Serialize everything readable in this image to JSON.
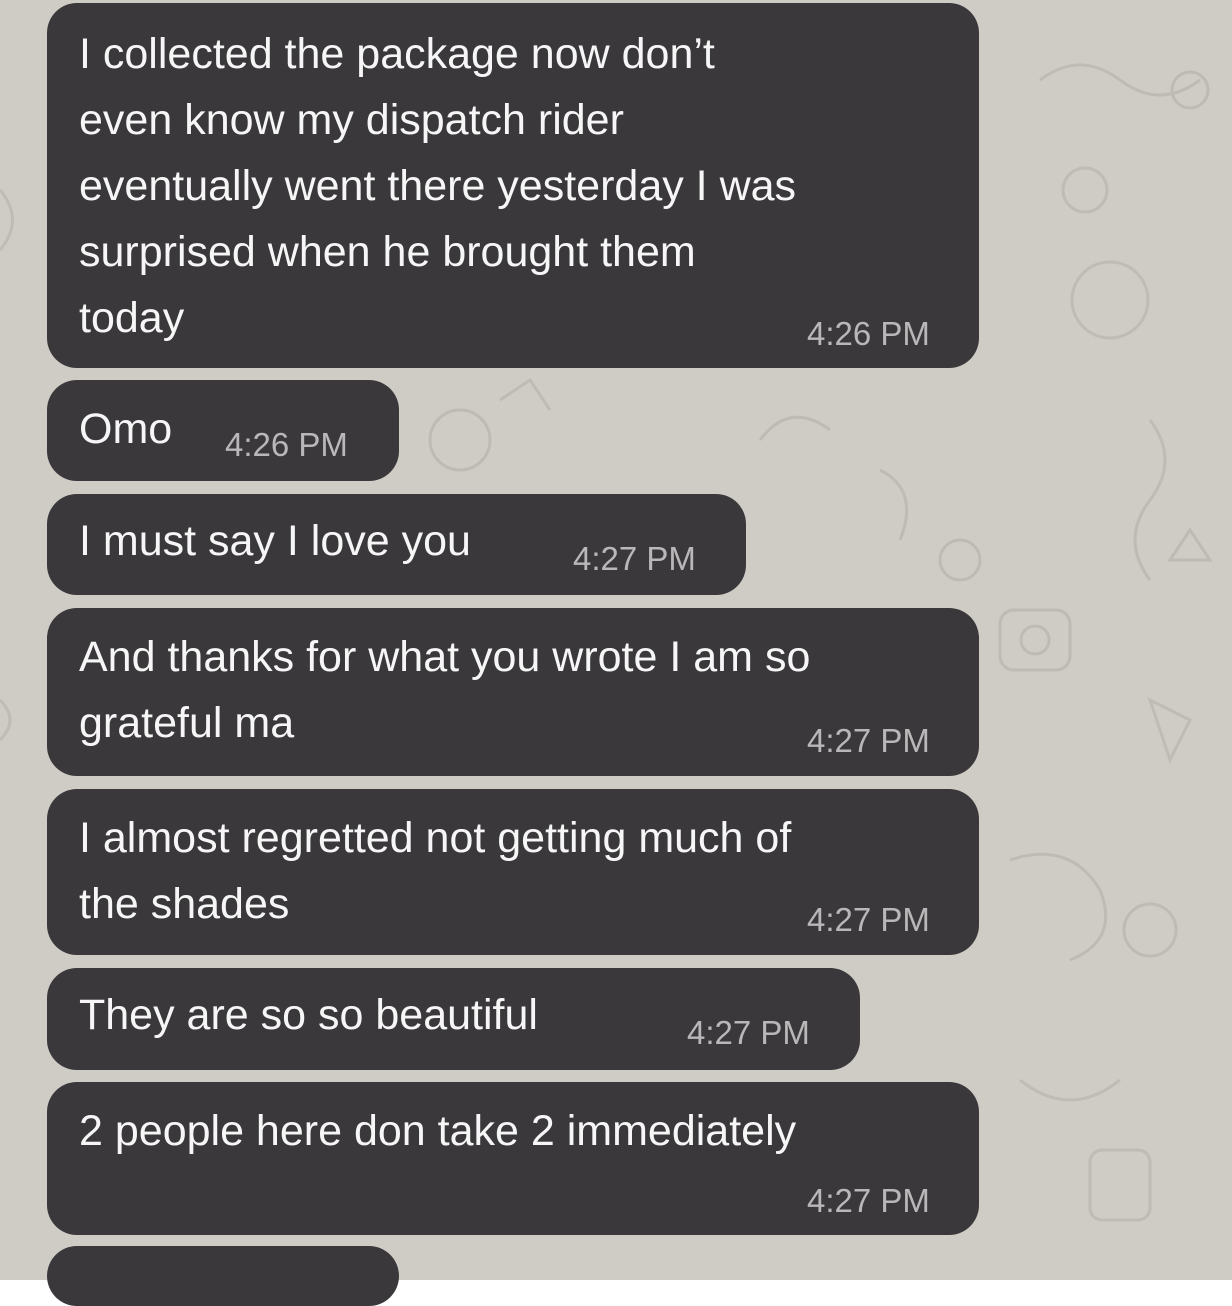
{
  "conversation": {
    "messages": [
      {
        "text": "I collected the package now don’t\neven know my dispatch rider\neventually went there yesterday I was\nsurprised when he brought them\ntoday",
        "time": "4:26 PM"
      },
      {
        "text": "Omo",
        "time": "4:26 PM"
      },
      {
        "text": "I must say I love you",
        "time": "4:27 PM"
      },
      {
        "text": "And thanks for what you wrote I am so\ngrateful ma",
        "time": "4:27 PM"
      },
      {
        "text": "I almost regretted not getting much of\nthe shades",
        "time": "4:27 PM"
      },
      {
        "text": "They are so so beautiful",
        "time": "4:27 PM"
      },
      {
        "text": "2 people here don take 2 immediately",
        "time": "4:27 PM"
      }
    ]
  },
  "colors": {
    "chat_background": "#cfccc6",
    "bubble_background": "#3a383b",
    "message_text": "#f6f6f6",
    "timestamp_text": "#b9b7b8"
  }
}
